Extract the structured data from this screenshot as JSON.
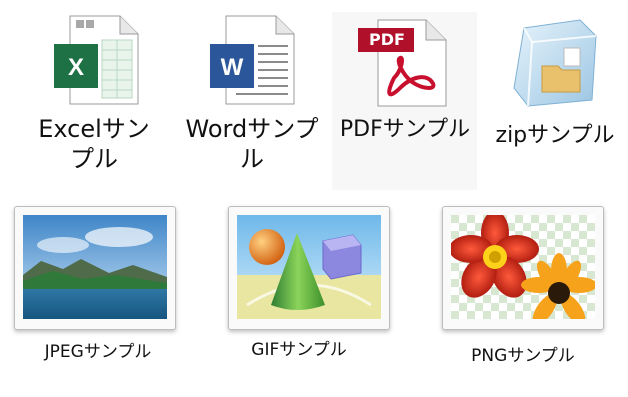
{
  "files": [
    {
      "key": "excel",
      "label": "Excelサンプル",
      "icon": "excel-file-icon"
    },
    {
      "key": "word",
      "label": "Wordサンプル",
      "icon": "word-file-icon"
    },
    {
      "key": "pdf",
      "label": "PDFサンプル",
      "icon": "pdf-file-icon",
      "badge": "PDF"
    },
    {
      "key": "zip",
      "label": "zipサンプル",
      "icon": "zip-folder-icon"
    },
    {
      "key": "jpeg",
      "label": "JPEGサンプル",
      "icon": "jpeg-image-icon"
    },
    {
      "key": "gif",
      "label": "GIFサンプル",
      "icon": "gif-image-icon"
    },
    {
      "key": "png",
      "label": "PNGサンプル",
      "icon": "png-image-icon"
    }
  ],
  "colors": {
    "excel": "#1e7145",
    "word": "#2b579a",
    "pdf": "#c8102e"
  }
}
